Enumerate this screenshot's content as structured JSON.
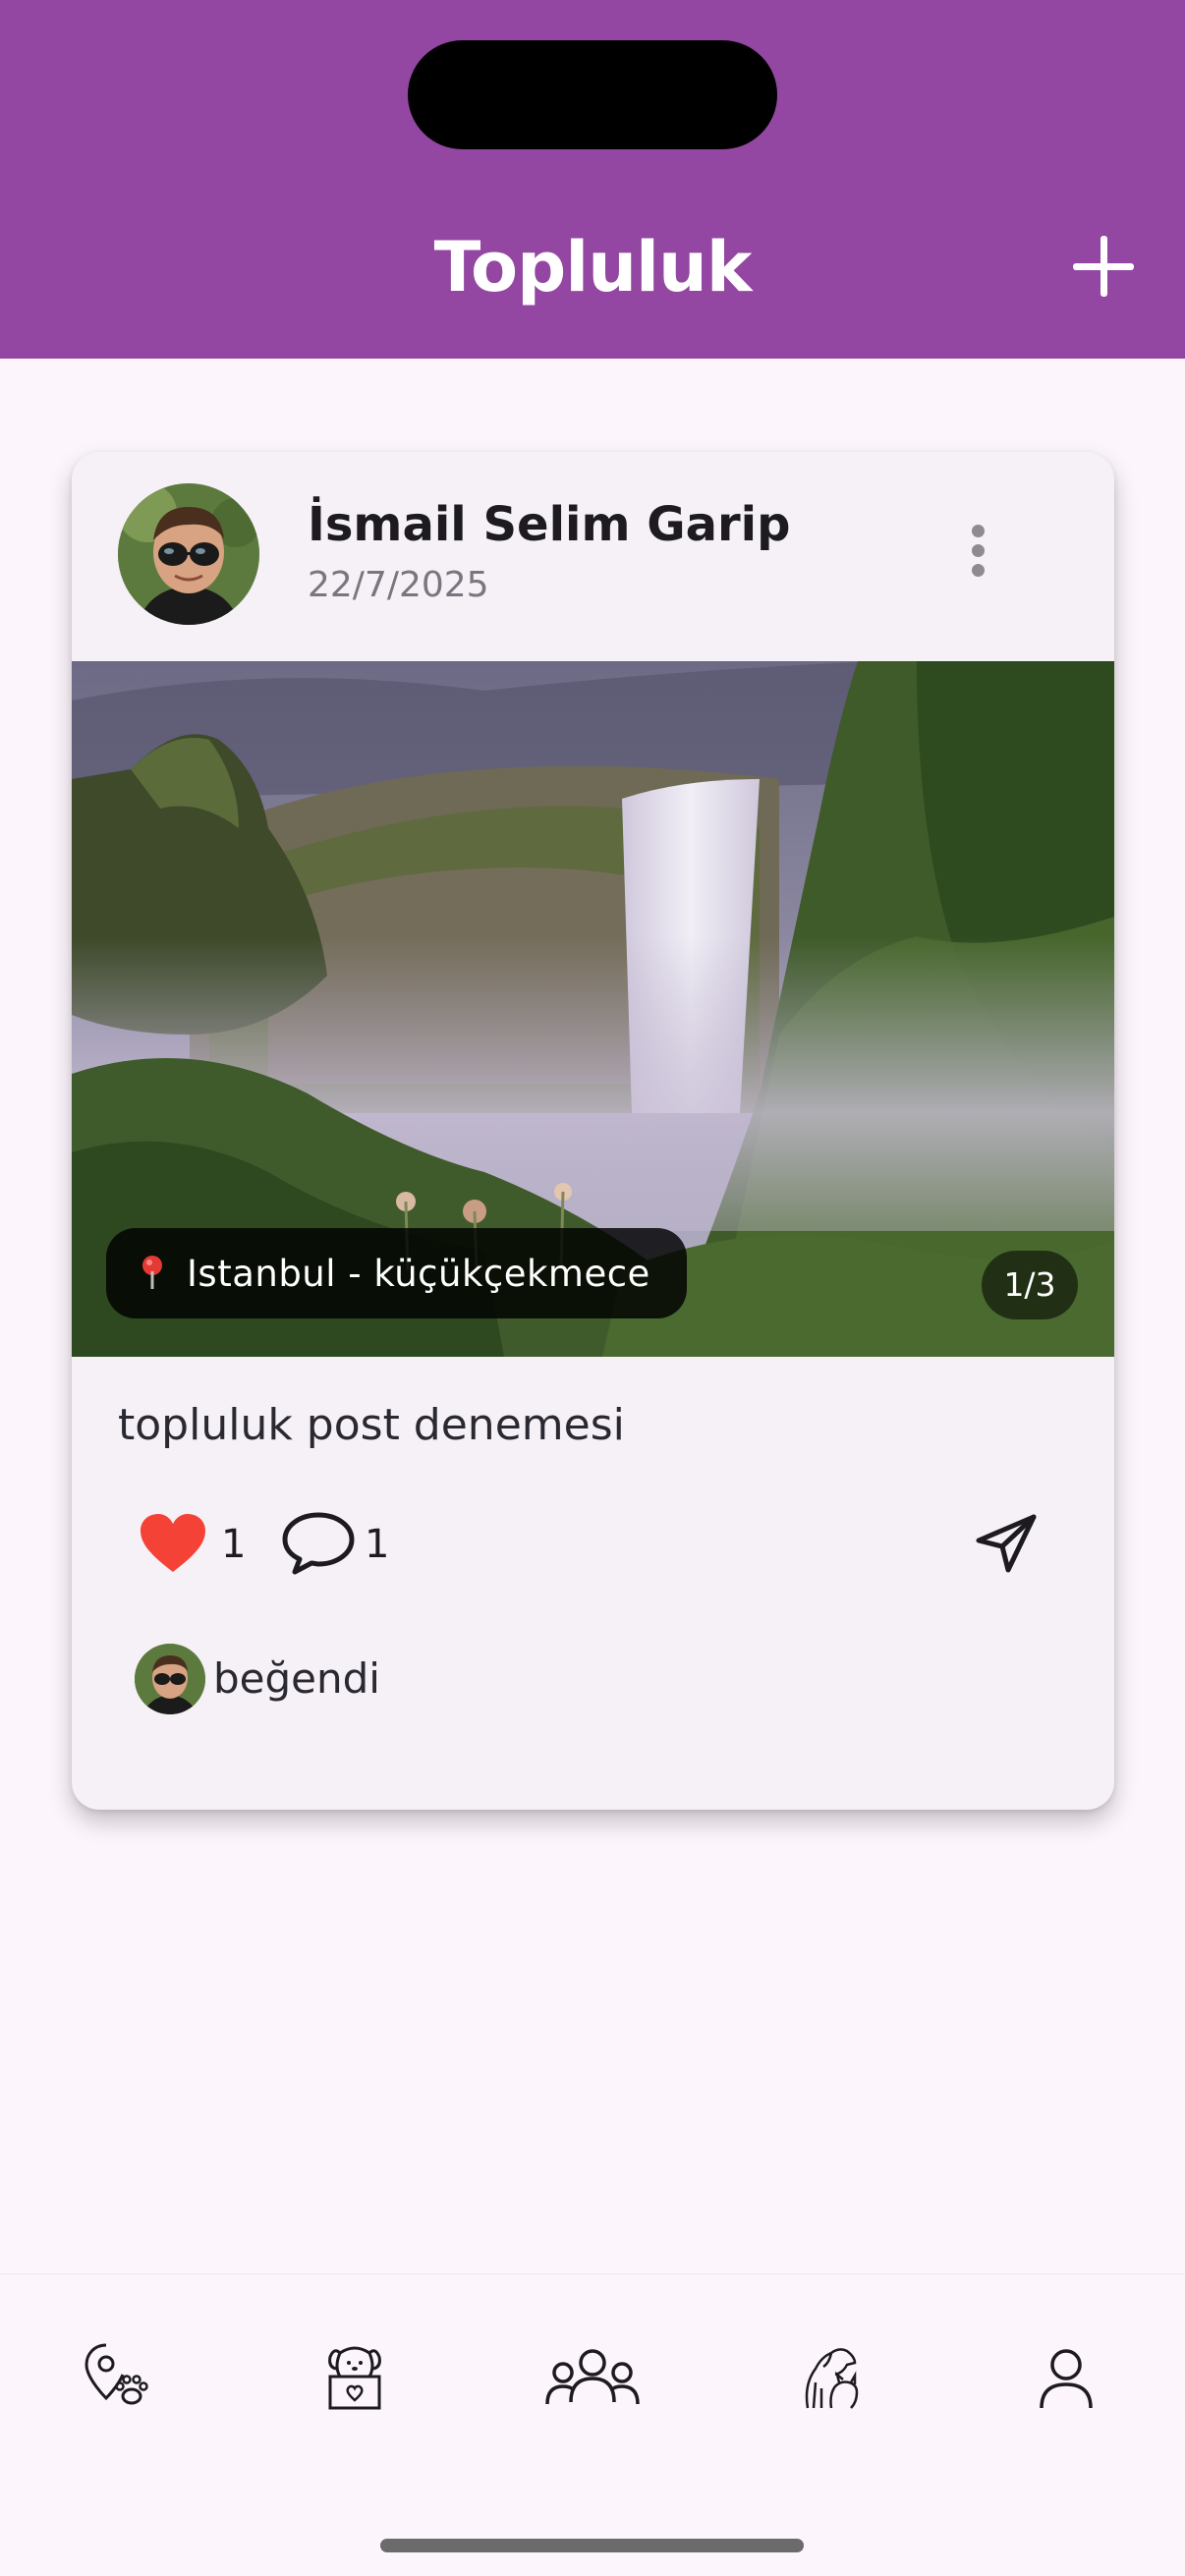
{
  "header": {
    "title": "Topluluk",
    "add_icon": "plus-icon",
    "background_color": "#9347a2"
  },
  "post": {
    "author": "İsmail Selim Garip",
    "date": "22/7/2025",
    "more_icon": "more-vertical-icon",
    "location": "Istanbul - küçükçekmece",
    "location_icon": "pin-icon",
    "image_counter": "1/3",
    "caption": "topluluk post denemesi",
    "like_count": "1",
    "comment_count": "1",
    "liked": true,
    "like_color": "#f44336",
    "liked_by_text": "beğendi"
  },
  "bottom_nav": {
    "items": [
      {
        "name": "map-paw-icon",
        "active": false
      },
      {
        "name": "adoption-pet-icon",
        "active": false
      },
      {
        "name": "community-icon",
        "active": true
      },
      {
        "name": "pets-icon",
        "active": false
      },
      {
        "name": "profile-icon",
        "active": false
      }
    ]
  }
}
